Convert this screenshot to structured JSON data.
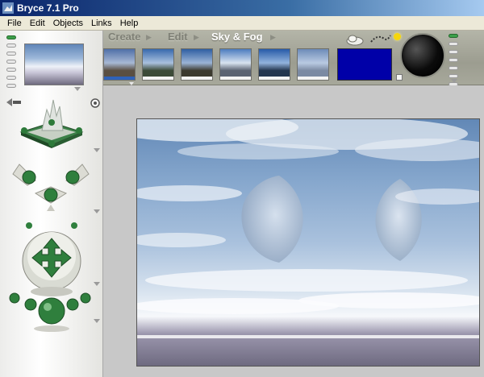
{
  "window": {
    "title": "Bryce 7.1  Pro",
    "icon": "bryce-app-icon"
  },
  "menubar": {
    "items": [
      "File",
      "Edit",
      "Objects",
      "Links",
      "Help"
    ]
  },
  "toolbar": {
    "tabs": {
      "create": "Create",
      "edit": "Edit",
      "sky_fog": "Sky & Fog"
    },
    "presets": [
      {
        "name": "sky-preset-1",
        "colors": [
          "#4f6fa8",
          "#a7b8d4",
          "#5a4f41"
        ]
      },
      {
        "name": "sky-preset-2",
        "colors": [
          "#3869ad",
          "#a9c0de",
          "#3c4b38"
        ]
      },
      {
        "name": "sky-preset-3",
        "colors": [
          "#2f5ea2",
          "#9bb4d6",
          "#3c3a2f"
        ]
      },
      {
        "name": "sky-preset-4",
        "colors": [
          "#4c7cbf",
          "#d8e3f0",
          "#5b6372"
        ]
      },
      {
        "name": "sky-preset-5",
        "colors": [
          "#275aa8",
          "#92b3dd",
          "#23364f"
        ]
      },
      {
        "name": "sky-preset-6",
        "colors": [
          "#6c8bb8",
          "#b9cae2",
          "#7b8aa3"
        ]
      }
    ],
    "fog_color": "#0000a8"
  },
  "icons": {
    "cloud": "cloud-icon",
    "sun": "sun-icon",
    "sun_dial": "sun-dial-icon",
    "camera_cube": "view-cube-icon",
    "nav_cross": "navigation-cross-icon",
    "trackball": "trackball-icon",
    "spheres": "render-spheres-icon"
  }
}
